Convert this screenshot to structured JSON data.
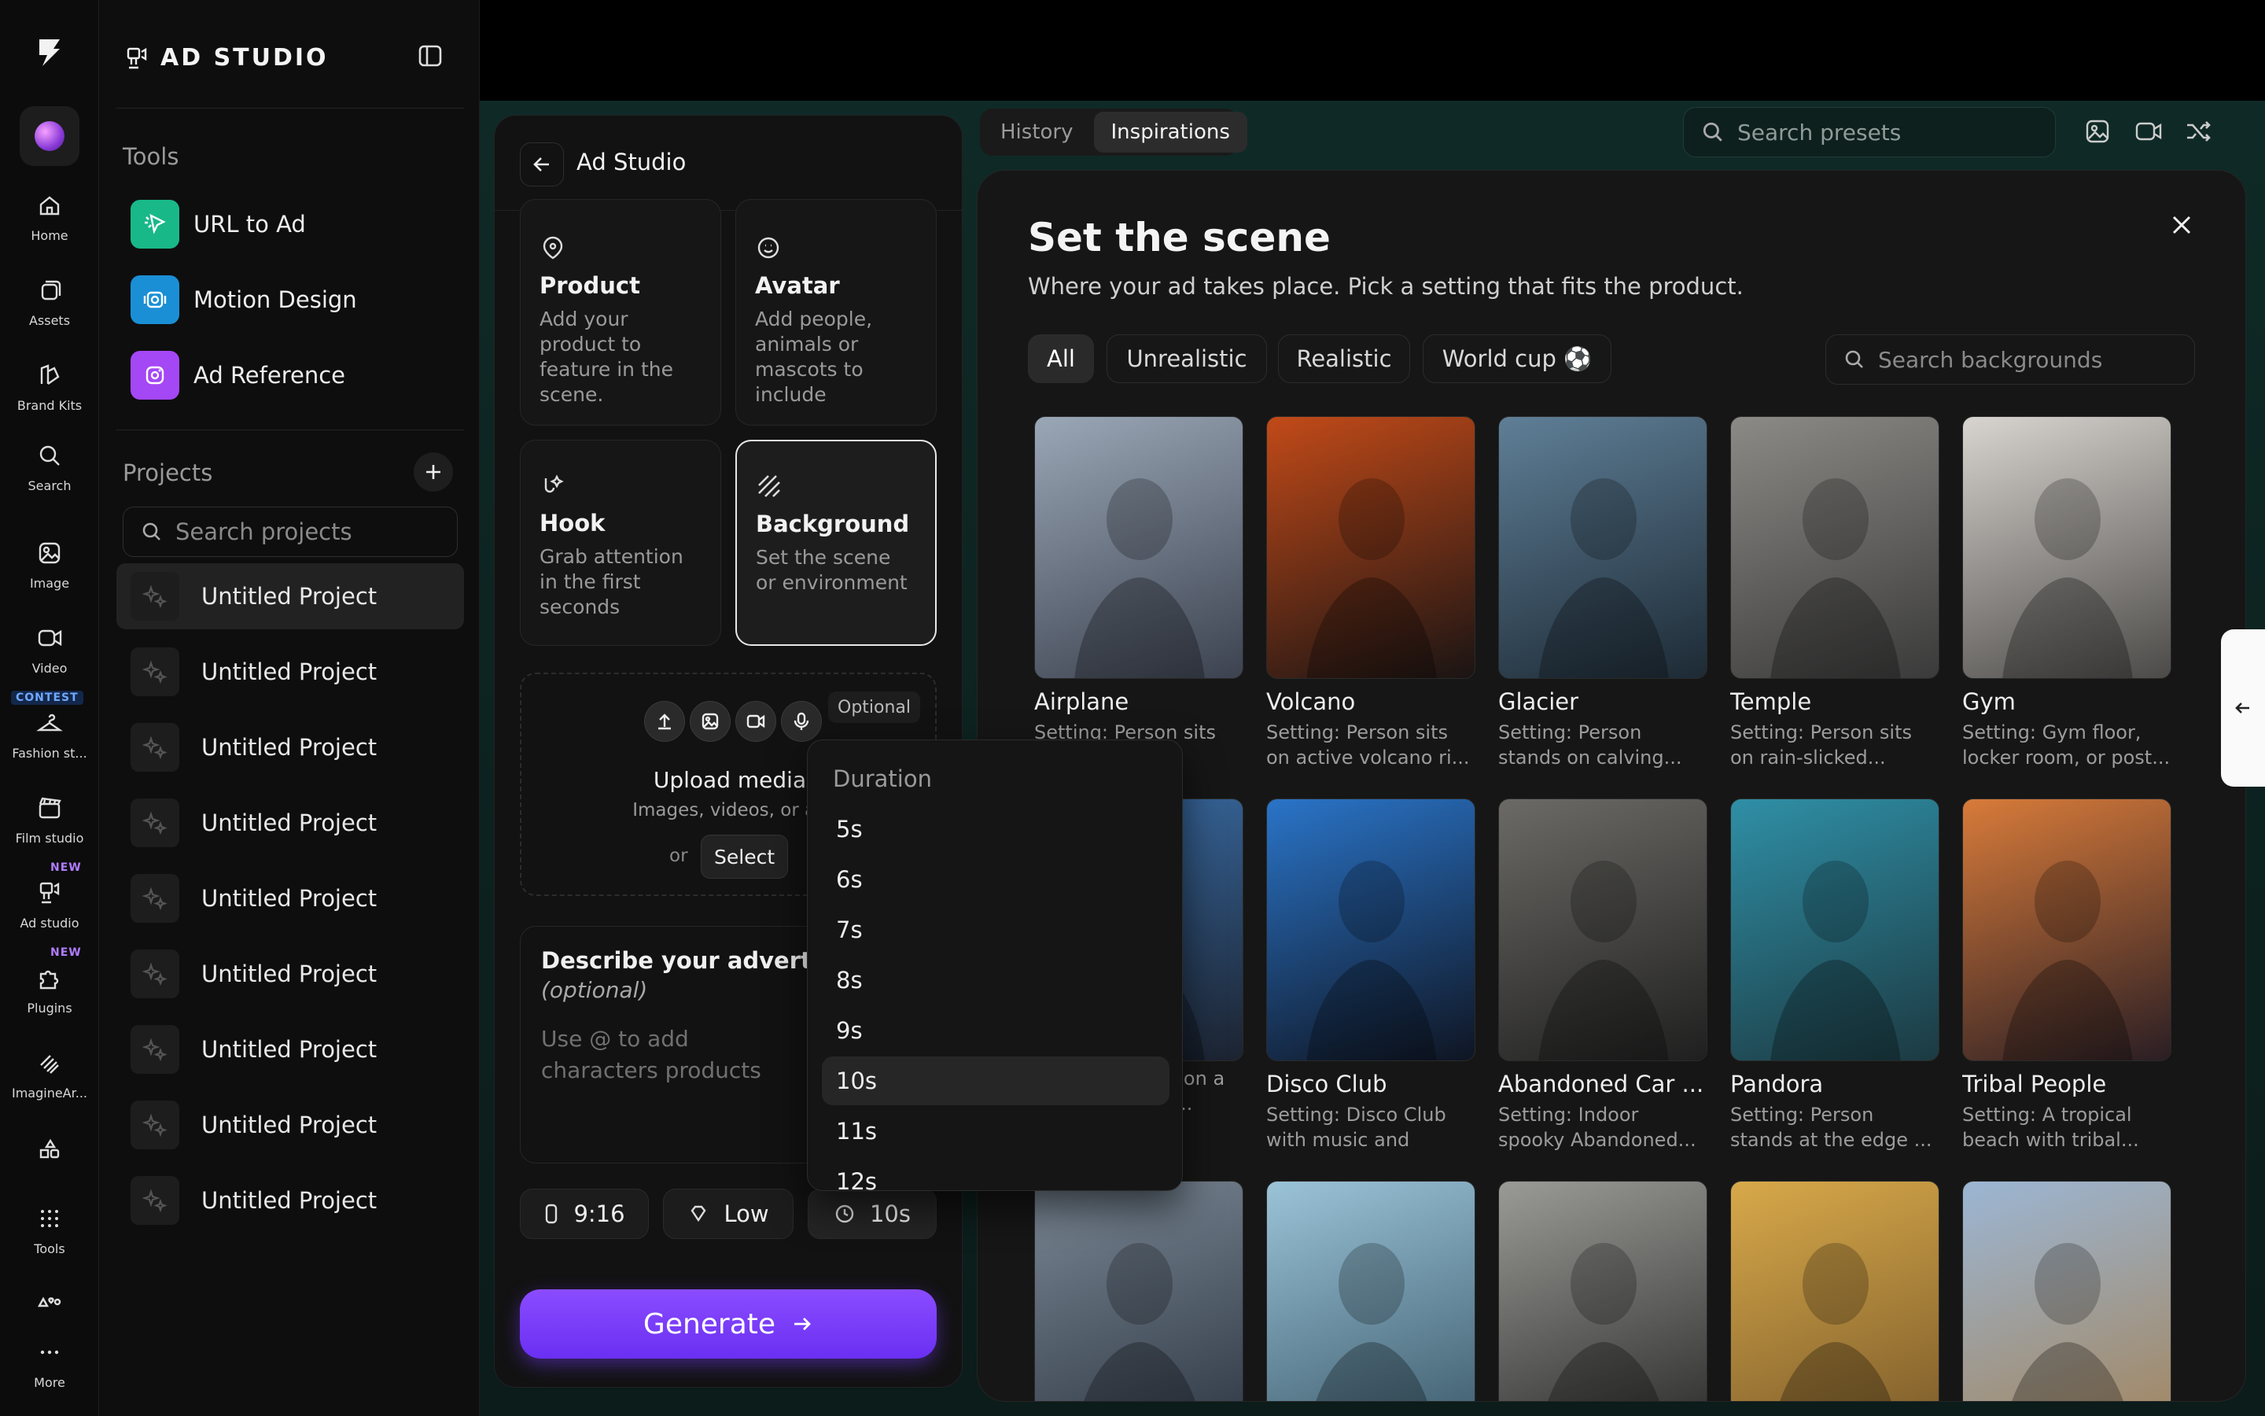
{
  "rail": {
    "items": [
      {
        "label": "Home",
        "icon": "home-icon"
      },
      {
        "label": "Assets",
        "icon": "assets-icon"
      },
      {
        "label": "Brand Kits",
        "icon": "brand-kits-icon"
      },
      {
        "label": "Search",
        "icon": "search-icon"
      },
      {
        "label": "Image",
        "icon": "image-icon"
      },
      {
        "label": "Video",
        "icon": "video-icon"
      },
      {
        "label": "Fashion st...",
        "icon": "hanger-icon",
        "badge": "CONTEST"
      },
      {
        "label": "Film studio",
        "icon": "clapper-icon"
      },
      {
        "label": "Ad studio",
        "icon": "ad-studio-icon",
        "badge": "NEW"
      },
      {
        "label": "Plugins",
        "icon": "puzzle-icon",
        "badge": "NEW"
      },
      {
        "label": "ImagineAr...",
        "icon": "layers-icon"
      },
      {
        "label": "",
        "icon": "shapes-icon"
      },
      {
        "label": "Tools",
        "icon": "grid-icon"
      },
      {
        "label": "",
        "icon": "shapes-alt-icon"
      },
      {
        "label": "More",
        "icon": "more-icon"
      }
    ]
  },
  "sidebar": {
    "title": "AD STUDIO",
    "tools_heading": "Tools",
    "tools": [
      {
        "label": "URL to Ad",
        "color": "#19b889"
      },
      {
        "label": "Motion Design",
        "color": "#1a8fd6"
      },
      {
        "label": "Ad Reference",
        "color": "#a447f5"
      }
    ],
    "projects_heading": "Projects",
    "search_placeholder": "Search projects",
    "projects": [
      "Untitled Project",
      "Untitled Project",
      "Untitled Project",
      "Untitled Project",
      "Untitled Project",
      "Untitled Project",
      "Untitled Project",
      "Untitled Project",
      "Untitled Project"
    ]
  },
  "form": {
    "title": "Ad Studio",
    "cards": [
      {
        "title": "Product",
        "desc": "Add your product to feature in the scene.",
        "icon": "tag-icon"
      },
      {
        "title": "Avatar",
        "desc": "Add people, animals or mascots to include",
        "icon": "face-icon"
      },
      {
        "title": "Hook",
        "desc": "Grab attention in the first seconds",
        "icon": "hook-icon"
      },
      {
        "title": "Background",
        "desc": "Set the scene or environment",
        "icon": "stripes-icon"
      }
    ],
    "upload": {
      "optional": "Optional",
      "title": "Upload media",
      "subtitle": "Images, videos, or au",
      "or": "or",
      "select": "Select"
    },
    "describe": {
      "title": "Describe your advertise",
      "optional": "(optional)",
      "placeholder": "Use @ to add characters products"
    },
    "settings": {
      "ratio": "9:16",
      "quality": "Low",
      "duration": "10s"
    },
    "generate": "Generate"
  },
  "duration_menu": {
    "heading": "Duration",
    "options": [
      "5s",
      "6s",
      "7s",
      "8s",
      "9s",
      "10s",
      "11s",
      "12s"
    ],
    "selected": "10s"
  },
  "topbar": {
    "tabs": [
      {
        "label": "History"
      },
      {
        "label": "Inspirations"
      }
    ],
    "active_tab": "Inspirations",
    "search_placeholder": "Search presets"
  },
  "scene": {
    "title": "Set the scene",
    "subtitle": "Where your ad takes place. Pick a setting that fits the product.",
    "filters": [
      "All",
      "Unrealistic",
      "Realistic",
      "World cup ⚽"
    ],
    "active_filter": "All",
    "search_placeholder": "Search backgrounds",
    "tiles": [
      {
        "name": "Airplane",
        "desc": "Setting: Person sits on a flying mi...",
        "c1": "#9aa7b6",
        "c2": "#3c4250"
      },
      {
        "name": "Volcano",
        "desc": "Setting: Person sits on active volcano ri...",
        "c1": "#c24a18",
        "c2": "#1a1414"
      },
      {
        "name": "Glacier",
        "desc": "Setting: Person stands on calving...",
        "c1": "#5f7f97",
        "c2": "#1d2a35"
      },
      {
        "name": "Temple",
        "desc": "Setting: Person sits on rain-slicked...",
        "c1": "#8c8a86",
        "c2": "#3a3a3a"
      },
      {
        "name": "Gym",
        "desc": "Setting: Gym floor, locker room, or post...",
        "c1": "#d8d4cf",
        "c2": "#4c4a48"
      },
      {
        "name": "",
        "desc": "Setting: Person on a stadium landin...",
        "c1": "#3a6ea8",
        "c2": "#1c2330"
      },
      {
        "name": "Disco Club",
        "desc": "Setting: Disco Club with music and othe...",
        "c1": "#2a74c8",
        "c2": "#0f1522"
      },
      {
        "name": "Abandoned Car ...",
        "desc": "Setting: Indoor spooky Abandoned...",
        "c1": "#6b6a66",
        "c2": "#1f1f1f"
      },
      {
        "name": "Pandora",
        "desc": "Setting: Person stands at the edge ...",
        "c1": "#2f8fa6",
        "c2": "#1c3a42"
      },
      {
        "name": "Tribal People",
        "desc": "Setting: A tropical beach with tribal...",
        "c1": "#d87b3a",
        "c2": "#2a1e24"
      },
      {
        "name": "",
        "desc": "",
        "c1": "#7a8794",
        "c2": "#2e3744"
      },
      {
        "name": "",
        "desc": "",
        "c1": "#9bc3d8",
        "c2": "#3b5a6a"
      },
      {
        "name": "",
        "desc": "",
        "c1": "#9a9a96",
        "c2": "#2a2a2a"
      },
      {
        "name": "",
        "desc": "",
        "c1": "#d8a94a",
        "c2": "#7a5a2a"
      },
      {
        "name": "",
        "desc": "",
        "c1": "#9cb6d4",
        "c2": "#a2845c"
      }
    ]
  }
}
